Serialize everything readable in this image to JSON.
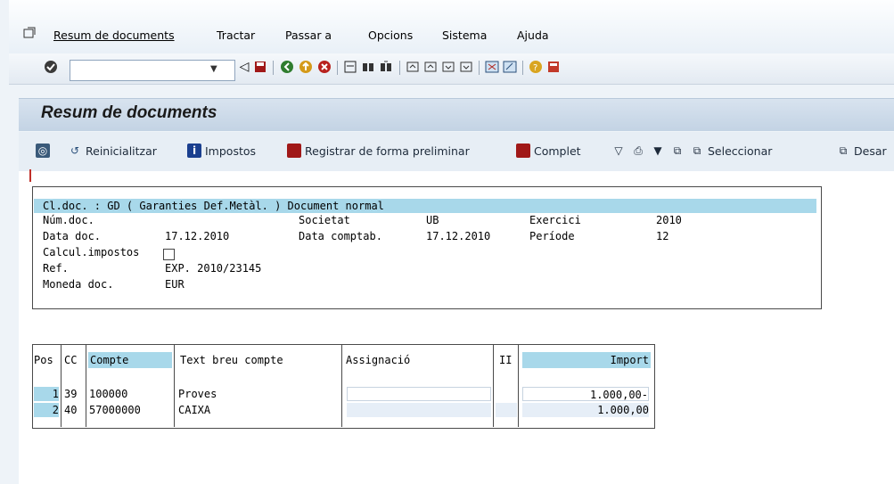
{
  "menu": {
    "items": [
      "Resum de documents",
      "Tractar",
      "Passar a",
      "Opcions",
      "Sistema",
      "Ajuda"
    ]
  },
  "toolbar": {
    "command_value": ""
  },
  "screen": {
    "title": "Resum de documents"
  },
  "app_toolbar": {
    "reset_label": "Reinicialitzar",
    "taxes_label": "Impostos",
    "park_label": "Registrar de forma preliminar",
    "complete_label": "Complet",
    "select_label": "Seleccionar",
    "deselect_label": "Desar"
  },
  "header": {
    "line1": "Cl.doc. : GD ( Garanties Def.Metàl. ) Document normal",
    "doc_no_label": "Núm.doc.",
    "company_label": "Societat",
    "company_value": "UB",
    "fiscal_year_label": "Exercici",
    "fiscal_year_value": "2010",
    "doc_date_label": "Data doc.",
    "doc_date_value": "17.12.2010",
    "posting_date_label": "Data comptab.",
    "posting_date_value": "17.12.2010",
    "period_label": "Període",
    "period_value": "12",
    "calc_tax_label": "Calcul.impostos",
    "ref_label": "Ref.",
    "ref_value": "EXP. 2010/23145",
    "currency_label": "Moneda doc.",
    "currency_value": "EUR"
  },
  "table": {
    "columns": [
      "Pos",
      "CC",
      "Compte",
      "Text breu compte",
      "Assignació",
      "II",
      "Import"
    ],
    "rows": [
      {
        "pos": "1",
        "cc": "39",
        "account": "100000",
        "text": "Proves",
        "assignment": "",
        "ii": "",
        "amount": "1.000,00-"
      },
      {
        "pos": "2",
        "cc": "40",
        "account": "57000000",
        "text": "CAIXA",
        "assignment": "",
        "ii": "",
        "amount": "1.000,00"
      }
    ]
  },
  "colors": {
    "accent": "#a8d8ea",
    "title_bg": "#c8d7e7",
    "frame": "#eef3f8"
  }
}
